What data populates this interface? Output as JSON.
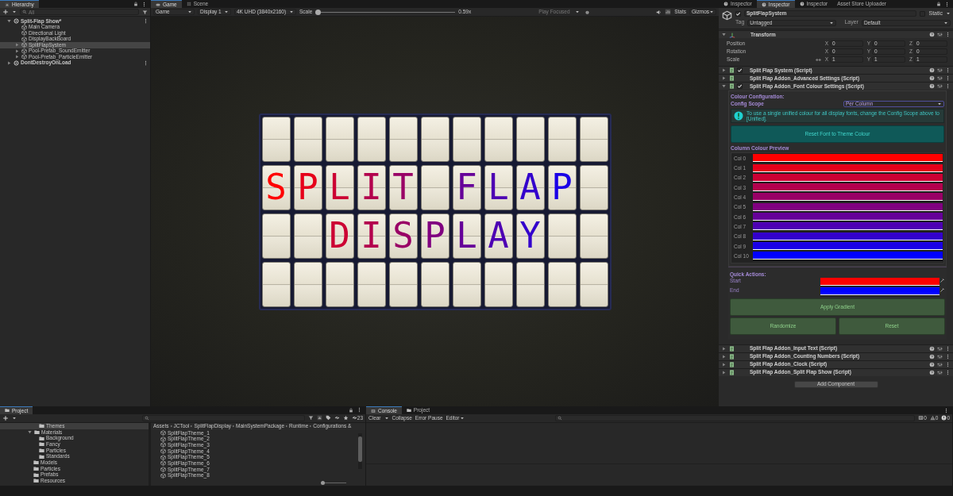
{
  "hierarchy": {
    "title": "Hierarchy",
    "search": {
      "placeholder": "All"
    },
    "items": [
      {
        "label": "Split-Flap Show*",
        "kind": "scene",
        "expanded": true,
        "selected": false,
        "children": [
          {
            "label": "Main Camera",
            "kind": "object",
            "selected": false
          },
          {
            "label": "Directional Light",
            "kind": "object",
            "selected": false
          },
          {
            "label": "DisplayBackBoard",
            "kind": "object",
            "selected": false
          },
          {
            "label": "SplitFlapSystem",
            "kind": "group",
            "expanded": false,
            "selected": true
          },
          {
            "label": "Pool-Prefab_SoundEmitter",
            "kind": "group",
            "expanded": false,
            "selected": false
          },
          {
            "label": "Pool-Prefab_ParticleEmitter",
            "kind": "group",
            "expanded": false,
            "selected": false
          }
        ]
      },
      {
        "label": "DontDestroyOnLoad",
        "kind": "scene",
        "expanded": false,
        "selected": false
      }
    ]
  },
  "game": {
    "tabs": [
      {
        "label": "Game",
        "kind": "game",
        "selected": true
      },
      {
        "label": "Scene",
        "kind": "scene",
        "selected": false
      }
    ],
    "toolbar": {
      "view": "Game",
      "display": "Display 1",
      "resolution": "4K UHD (3840x2160)",
      "scale_label": "Scale",
      "scale": {
        "level": 0.0
      },
      "scale_reading": "0.59x",
      "play_mode": "Play Focused",
      "stats": "Stats",
      "gizmos": "Gizmos"
    },
    "board": {
      "rows": [
        {
          "cells": [
            {
              "kind": "blank"
            },
            {
              "kind": "blank"
            },
            {
              "kind": "blank"
            },
            {
              "kind": "blank"
            },
            {
              "kind": "blank"
            },
            {
              "kind": "blank"
            },
            {
              "kind": "blank"
            },
            {
              "kind": "blank"
            },
            {
              "kind": "blank"
            },
            {
              "kind": "blank"
            },
            {
              "kind": "blank"
            }
          ]
        },
        {
          "cells": [
            {
              "kind": "letter",
              "letter": "S"
            },
            {
              "kind": "letter",
              "letter": "P"
            },
            {
              "kind": "letter",
              "letter": "L"
            },
            {
              "kind": "letter",
              "letter": "I"
            },
            {
              "kind": "letter",
              "letter": "T"
            },
            {
              "kind": "blank"
            },
            {
              "kind": "letter",
              "letter": "F"
            },
            {
              "kind": "letter",
              "letter": "L"
            },
            {
              "kind": "letter",
              "letter": "A"
            },
            {
              "kind": "letter",
              "letter": "P"
            },
            {
              "kind": "blank"
            }
          ]
        },
        {
          "cells": [
            {
              "kind": "blank"
            },
            {
              "kind": "blank"
            },
            {
              "kind": "letter",
              "letter": "D"
            },
            {
              "kind": "letter",
              "letter": "I"
            },
            {
              "kind": "letter",
              "letter": "S"
            },
            {
              "kind": "letter",
              "letter": "P"
            },
            {
              "kind": "letter",
              "letter": "L"
            },
            {
              "kind": "letter",
              "letter": "A"
            },
            {
              "kind": "letter",
              "letter": "Y"
            },
            {
              "kind": "blank"
            },
            {
              "kind": "blank"
            }
          ]
        },
        {
          "cells": [
            {
              "kind": "blank"
            },
            {
              "kind": "blank"
            },
            {
              "kind": "blank"
            },
            {
              "kind": "blank"
            },
            {
              "kind": "blank"
            },
            {
              "kind": "blank"
            },
            {
              "kind": "blank"
            },
            {
              "kind": "blank"
            },
            {
              "kind": "blank"
            },
            {
              "kind": "blank"
            },
            {
              "kind": "blank"
            }
          ]
        }
      ]
    }
  },
  "inspector": {
    "tabs": [
      {
        "label": "Inspector",
        "selected": false
      },
      {
        "label": "Inspector",
        "selected": true
      },
      {
        "label": "Inspector",
        "selected": false
      },
      {
        "label": "Asset Store Uploader",
        "selected": false
      }
    ],
    "object": {
      "active": true,
      "name": "SplitFlapSystem",
      "static_label": "Static",
      "static": false,
      "tag_label": "Tag",
      "tag": "Untagged",
      "layer_label": "Layer",
      "layer": "Default"
    },
    "transform": {
      "title": "Transform",
      "rows": [
        {
          "label": "Position",
          "values": [
            {
              "axis": "X",
              "value": "0"
            },
            {
              "axis": "Y",
              "value": "0"
            },
            {
              "axis": "Z",
              "value": "0"
            }
          ]
        },
        {
          "label": "Rotation",
          "values": [
            {
              "axis": "X",
              "value": "0"
            },
            {
              "axis": "Y",
              "value": "0"
            },
            {
              "axis": "Z",
              "value": "0"
            }
          ]
        },
        {
          "label": "Scale",
          "linked": true,
          "values": [
            {
              "axis": "X",
              "value": "1"
            },
            {
              "axis": "Y",
              "value": "1"
            },
            {
              "axis": "Z",
              "value": "1"
            }
          ]
        }
      ]
    },
    "components": [
      {
        "title": "Split Flap System (Script)",
        "checked": true,
        "expanded": false
      },
      {
        "title": "Split Flap Addon_Advanced Settings (Script)",
        "checked": false,
        "expanded": false
      },
      {
        "title": "Split Flap Addon_Font Colour Settings (Script)",
        "checked": true,
        "expanded": true
      }
    ],
    "font_colour": {
      "heading": "Colour Configuration:",
      "scope_label": "Config Scope",
      "scope": "Per Column",
      "info": "To use a single unified colour for all display fonts, change the Config Scope above to [Unified].",
      "reset_button": "Reset Font to Theme Colour",
      "preview_heading": "Column Colour Preview",
      "columns": [
        {
          "label": "Col 0",
          "color": "#ff0000"
        },
        {
          "label": "Col 1",
          "color": "#e6001a"
        },
        {
          "label": "Col 2",
          "color": "#cc0033"
        },
        {
          "label": "Col 3",
          "color": "#b3004d"
        },
        {
          "label": "Col 4",
          "color": "#990066"
        },
        {
          "label": "Col 5",
          "color": "#800080"
        },
        {
          "label": "Col 6",
          "color": "#660099"
        },
        {
          "label": "Col 7",
          "color": "#4d00b3"
        },
        {
          "label": "Col 8",
          "color": "#3300cc"
        },
        {
          "label": "Col 9",
          "color": "#1a00e6"
        },
        {
          "label": "Col 10",
          "color": "#0000ff"
        }
      ],
      "quick_actions": {
        "heading": "Quick Actions:",
        "start": {
          "label": "Start",
          "color": "#ff0000"
        },
        "end": {
          "label": "End",
          "color": "#0000ff"
        },
        "apply_button": "Apply Gradient",
        "randomize_button": "Randomize",
        "reset_button": "Reset"
      }
    },
    "more_components": [
      {
        "title": "Split Flap Addon_Input Text (Script)",
        "checked": false,
        "expanded": false
      },
      {
        "title": "Split Flap Addon_Counting Numbers (Script)",
        "checked": false,
        "expanded": false
      },
      {
        "title": "Split Flap Addon_Clock (Script)",
        "checked": false,
        "expanded": false
      },
      {
        "title": "Split Flap Addon_Split Flap Show (Script)",
        "checked": false,
        "expanded": false
      }
    ],
    "add_component": "Add Component"
  },
  "project": {
    "title": "Project",
    "count": "23",
    "zoom": {
      "level": 0.0
    },
    "tree": [
      {
        "label": "Themes",
        "selected": true
      },
      {
        "label": "Materials",
        "selected": false,
        "expanded": true,
        "children": [
          {
            "label": "Background",
            "selected": false
          },
          {
            "label": "Fancy",
            "selected": false
          },
          {
            "label": "Particles",
            "selected": false
          },
          {
            "label": "Standards",
            "selected": false
          }
        ]
      },
      {
        "label": "Models",
        "selected": false
      },
      {
        "label": "Particles",
        "selected": false
      },
      {
        "label": "Prefabs",
        "selected": false
      },
      {
        "label": "Resources",
        "selected": false
      }
    ],
    "breadcrumb": [
      "Assets",
      "JCTool",
      "SplitFlapDisplay",
      "MainSystemPackage",
      "Runtime",
      "Configurations &"
    ],
    "files": [
      "SplitFlapTheme_1",
      "SplitFlapTheme_2",
      "SplitFlapTheme_3",
      "SplitFlapTheme_4",
      "SplitFlapTheme_5",
      "SplitFlapTheme_6",
      "SplitFlapTheme_7",
      "SplitFlapTheme_8"
    ]
  },
  "console": {
    "tabs": [
      {
        "label": "Console",
        "selected": true
      },
      {
        "label": "Project",
        "selected": false
      }
    ],
    "clear": "Clear",
    "collapse": "Collapse",
    "error_pause": "Error Pause",
    "editor": "Editor",
    "counts": [
      {
        "kind": "info",
        "value": "0"
      },
      {
        "kind": "warning",
        "value": "0"
      },
      {
        "kind": "error",
        "value": "0"
      }
    ]
  }
}
